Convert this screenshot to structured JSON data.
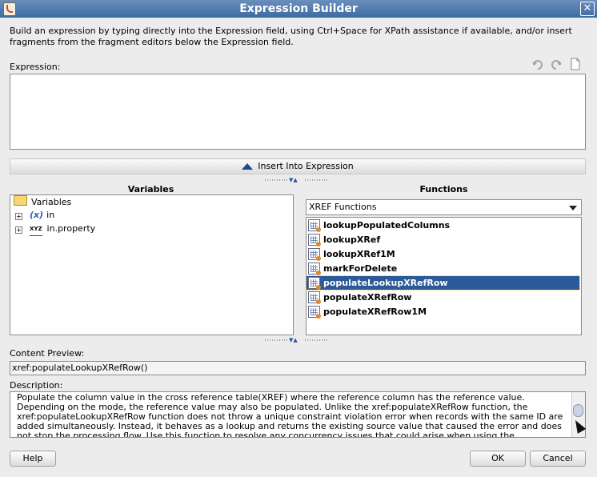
{
  "window": {
    "title": "Expression Builder"
  },
  "intro_text": "Build an expression by typing directly into the Expression field, using Ctrl+Space for XPath assistance if available, and/or insert fragments from the fragment editors below the Expression field.",
  "expression": {
    "label": "Expression:",
    "value": ""
  },
  "toolbar": {
    "undo": "undo-icon",
    "redo": "redo-icon",
    "clear": "clear-icon"
  },
  "insert_button": "Insert Into Expression",
  "variables": {
    "title": "Variables",
    "root": "Variables",
    "items": [
      {
        "label": "in",
        "icon": "variable-icon"
      },
      {
        "label": "in.property",
        "icon": "property-icon"
      }
    ]
  },
  "functions": {
    "title": "Functions",
    "category": "XREF Functions",
    "items": [
      "lookupPopulatedColumns",
      "lookupXRef",
      "lookupXRef1M",
      "markForDelete",
      "populateLookupXRefRow",
      "populateXRefRow",
      "populateXRefRow1M"
    ],
    "selected_index": 4
  },
  "content_preview": {
    "label": "Content Preview:",
    "value": "xref:populateLookupXRefRow()"
  },
  "description": {
    "label": "Description:",
    "text": "Populate the column value in the cross reference table(XREF) where the reference column has the reference value. Depending on the mode, the reference value may also be populated. Unlike the xref:populateXRefRow function, the xref:populateLookupXRefRow function does not throw a unique constraint violation error when records with the same ID are added simultaneously. Instead, it behaves as a lookup and returns the existing source value that caused the error and does not stop the processing flow. Use this function to resolve any concurrency issues that could arise when using the"
  },
  "buttons": {
    "help": "Help",
    "ok": "OK",
    "cancel": "Cancel"
  }
}
